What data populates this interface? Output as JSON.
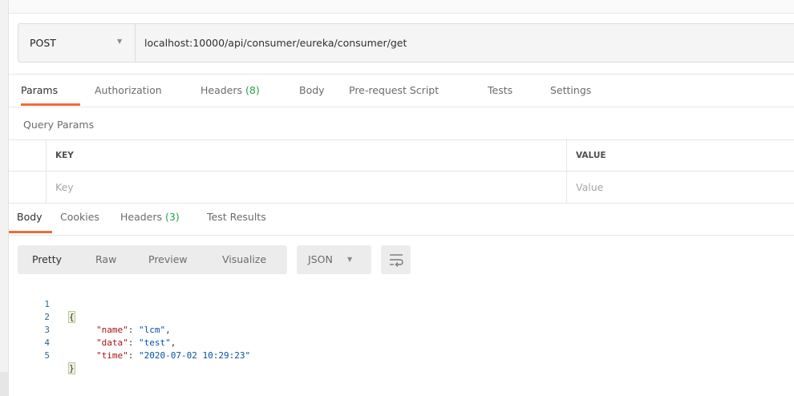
{
  "request": {
    "method": "POST",
    "url": "localhost:10000/api/consumer/eureka/consumer/get"
  },
  "request_tabs": [
    {
      "label": "Params",
      "count": "",
      "active": true
    },
    {
      "label": "Authorization",
      "count": ""
    },
    {
      "label": "Headers",
      "count": "(8)"
    },
    {
      "label": "Body",
      "count": ""
    },
    {
      "label": "Pre-request Script",
      "count": ""
    },
    {
      "label": "Tests",
      "count": ""
    },
    {
      "label": "Settings",
      "count": ""
    }
  ],
  "query_params": {
    "title": "Query Params",
    "key_header": "KEY",
    "value_header": "VALUE",
    "key_placeholder": "Key",
    "value_placeholder": "Value"
  },
  "response_tabs": [
    {
      "label": "Body",
      "count": "",
      "active": true
    },
    {
      "label": "Cookies",
      "count": ""
    },
    {
      "label": "Headers",
      "count": "(3)"
    },
    {
      "label": "Test Results",
      "count": ""
    }
  ],
  "view_modes": [
    "Pretty",
    "Raw",
    "Preview",
    "Visualize"
  ],
  "format": "JSON",
  "response_body": {
    "line_numbers": [
      "1",
      "2",
      "3",
      "4",
      "5"
    ],
    "open_brace": "{",
    "close_brace": "}",
    "fields": [
      {
        "key": "\"name\"",
        "value": "\"lcm\"",
        "sep": ","
      },
      {
        "key": "\"data\"",
        "value": "\"test\"",
        "sep": ","
      },
      {
        "key": "\"time\"",
        "value": "\"2020-07-02 10:29:23\"",
        "sep": ""
      }
    ]
  },
  "colors": {
    "accent_orange": "#f26b3a",
    "count_green": "#27a048",
    "json_key": "#a31515",
    "json_string": "#0451a5"
  }
}
